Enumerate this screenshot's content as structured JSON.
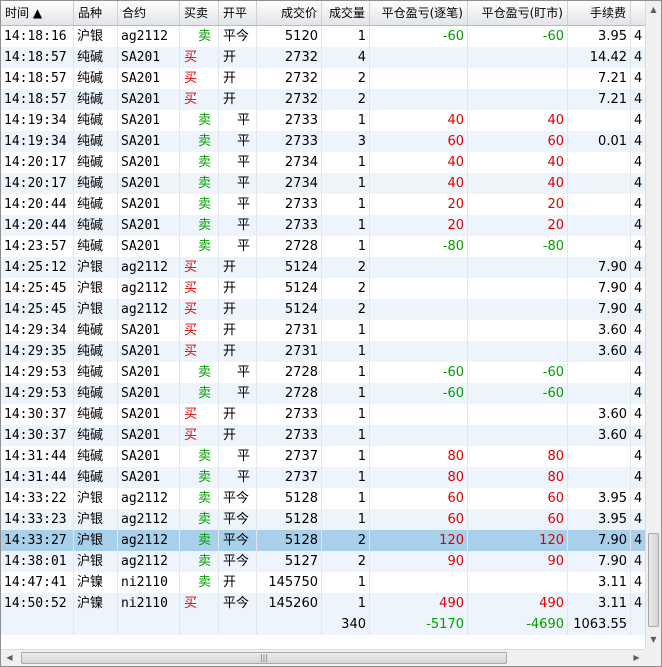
{
  "columns": [
    "时间 ▲",
    "品种",
    "合约",
    "买卖",
    "开平",
    "成交价",
    "成交量",
    "平仓盈亏(逐笔)",
    "平仓盈亏(盯市)",
    "手续费"
  ],
  "rows": [
    {
      "time": "14:18:16",
      "product": "沪银",
      "contract": "ag2112",
      "side": "卖",
      "action": "平今",
      "price": "5120",
      "qty": "1",
      "pnl_trade": "-60",
      "pnl_mtm": "-60",
      "fee": "3.95",
      "extra": "4"
    },
    {
      "time": "14:18:57",
      "product": "纯碱",
      "contract": "SA201",
      "side": "买",
      "action": "开",
      "price": "2732",
      "qty": "4",
      "pnl_trade": "",
      "pnl_mtm": "",
      "fee": "14.42",
      "extra": "4"
    },
    {
      "time": "14:18:57",
      "product": "纯碱",
      "contract": "SA201",
      "side": "买",
      "action": "开",
      "price": "2732",
      "qty": "2",
      "pnl_trade": "",
      "pnl_mtm": "",
      "fee": "7.21",
      "extra": "4"
    },
    {
      "time": "14:18:57",
      "product": "纯碱",
      "contract": "SA201",
      "side": "买",
      "action": "开",
      "price": "2732",
      "qty": "2",
      "pnl_trade": "",
      "pnl_mtm": "",
      "fee": "7.21",
      "extra": "4"
    },
    {
      "time": "14:19:34",
      "product": "纯碱",
      "contract": "SA201",
      "side": "卖",
      "action": "平",
      "price": "2733",
      "qty": "1",
      "pnl_trade": "40",
      "pnl_mtm": "40",
      "fee": "",
      "extra": "4"
    },
    {
      "time": "14:19:34",
      "product": "纯碱",
      "contract": "SA201",
      "side": "卖",
      "action": "平",
      "price": "2733",
      "qty": "3",
      "pnl_trade": "60",
      "pnl_mtm": "60",
      "fee": "0.01",
      "extra": "4"
    },
    {
      "time": "14:20:17",
      "product": "纯碱",
      "contract": "SA201",
      "side": "卖",
      "action": "平",
      "price": "2734",
      "qty": "1",
      "pnl_trade": "40",
      "pnl_mtm": "40",
      "fee": "",
      "extra": "4"
    },
    {
      "time": "14:20:17",
      "product": "纯碱",
      "contract": "SA201",
      "side": "卖",
      "action": "平",
      "price": "2734",
      "qty": "1",
      "pnl_trade": "40",
      "pnl_mtm": "40",
      "fee": "",
      "extra": "4"
    },
    {
      "time": "14:20:44",
      "product": "纯碱",
      "contract": "SA201",
      "side": "卖",
      "action": "平",
      "price": "2733",
      "qty": "1",
      "pnl_trade": "20",
      "pnl_mtm": "20",
      "fee": "",
      "extra": "4"
    },
    {
      "time": "14:20:44",
      "product": "纯碱",
      "contract": "SA201",
      "side": "卖",
      "action": "平",
      "price": "2733",
      "qty": "1",
      "pnl_trade": "20",
      "pnl_mtm": "20",
      "fee": "",
      "extra": "4"
    },
    {
      "time": "14:23:57",
      "product": "纯碱",
      "contract": "SA201",
      "side": "卖",
      "action": "平",
      "price": "2728",
      "qty": "1",
      "pnl_trade": "-80",
      "pnl_mtm": "-80",
      "fee": "",
      "extra": "4"
    },
    {
      "time": "14:25:12",
      "product": "沪银",
      "contract": "ag2112",
      "side": "买",
      "action": "开",
      "price": "5124",
      "qty": "2",
      "pnl_trade": "",
      "pnl_mtm": "",
      "fee": "7.90",
      "extra": "4"
    },
    {
      "time": "14:25:45",
      "product": "沪银",
      "contract": "ag2112",
      "side": "买",
      "action": "开",
      "price": "5124",
      "qty": "2",
      "pnl_trade": "",
      "pnl_mtm": "",
      "fee": "7.90",
      "extra": "4"
    },
    {
      "time": "14:25:45",
      "product": "沪银",
      "contract": "ag2112",
      "side": "买",
      "action": "开",
      "price": "5124",
      "qty": "2",
      "pnl_trade": "",
      "pnl_mtm": "",
      "fee": "7.90",
      "extra": "4"
    },
    {
      "time": "14:29:34",
      "product": "纯碱",
      "contract": "SA201",
      "side": "买",
      "action": "开",
      "price": "2731",
      "qty": "1",
      "pnl_trade": "",
      "pnl_mtm": "",
      "fee": "3.60",
      "extra": "4"
    },
    {
      "time": "14:29:35",
      "product": "纯碱",
      "contract": "SA201",
      "side": "买",
      "action": "开",
      "price": "2731",
      "qty": "1",
      "pnl_trade": "",
      "pnl_mtm": "",
      "fee": "3.60",
      "extra": "4"
    },
    {
      "time": "14:29:53",
      "product": "纯碱",
      "contract": "SA201",
      "side": "卖",
      "action": "平",
      "price": "2728",
      "qty": "1",
      "pnl_trade": "-60",
      "pnl_mtm": "-60",
      "fee": "",
      "extra": "4"
    },
    {
      "time": "14:29:53",
      "product": "纯碱",
      "contract": "SA201",
      "side": "卖",
      "action": "平",
      "price": "2728",
      "qty": "1",
      "pnl_trade": "-60",
      "pnl_mtm": "-60",
      "fee": "",
      "extra": "4"
    },
    {
      "time": "14:30:37",
      "product": "纯碱",
      "contract": "SA201",
      "side": "买",
      "action": "开",
      "price": "2733",
      "qty": "1",
      "pnl_trade": "",
      "pnl_mtm": "",
      "fee": "3.60",
      "extra": "4"
    },
    {
      "time": "14:30:37",
      "product": "纯碱",
      "contract": "SA201",
      "side": "买",
      "action": "开",
      "price": "2733",
      "qty": "1",
      "pnl_trade": "",
      "pnl_mtm": "",
      "fee": "3.60",
      "extra": "4"
    },
    {
      "time": "14:31:44",
      "product": "纯碱",
      "contract": "SA201",
      "side": "卖",
      "action": "平",
      "price": "2737",
      "qty": "1",
      "pnl_trade": "80",
      "pnl_mtm": "80",
      "fee": "",
      "extra": "4"
    },
    {
      "time": "14:31:44",
      "product": "纯碱",
      "contract": "SA201",
      "side": "卖",
      "action": "平",
      "price": "2737",
      "qty": "1",
      "pnl_trade": "80",
      "pnl_mtm": "80",
      "fee": "",
      "extra": "4"
    },
    {
      "time": "14:33:22",
      "product": "沪银",
      "contract": "ag2112",
      "side": "卖",
      "action": "平今",
      "price": "5128",
      "qty": "1",
      "pnl_trade": "60",
      "pnl_mtm": "60",
      "fee": "3.95",
      "extra": "4"
    },
    {
      "time": "14:33:23",
      "product": "沪银",
      "contract": "ag2112",
      "side": "卖",
      "action": "平今",
      "price": "5128",
      "qty": "1",
      "pnl_trade": "60",
      "pnl_mtm": "60",
      "fee": "3.95",
      "extra": "4"
    },
    {
      "time": "14:33:27",
      "product": "沪银",
      "contract": "ag2112",
      "side": "卖",
      "action": "平今",
      "price": "5128",
      "qty": "2",
      "pnl_trade": "120",
      "pnl_mtm": "120",
      "fee": "7.90",
      "extra": "4",
      "selected": true
    },
    {
      "time": "14:38:01",
      "product": "沪银",
      "contract": "ag2112",
      "side": "卖",
      "action": "平今",
      "price": "5127",
      "qty": "2",
      "pnl_trade": "90",
      "pnl_mtm": "90",
      "fee": "7.90",
      "extra": "4"
    },
    {
      "time": "14:47:41",
      "product": "沪镍",
      "contract": "ni2110",
      "side": "卖",
      "action": "开",
      "price": "145750",
      "qty": "1",
      "pnl_trade": "",
      "pnl_mtm": "",
      "fee": "3.11",
      "extra": "4"
    },
    {
      "time": "14:50:52",
      "product": "沪镍",
      "contract": "ni2110",
      "side": "买",
      "action": "平今",
      "price": "145260",
      "qty": "1",
      "pnl_trade": "490",
      "pnl_mtm": "490",
      "fee": "3.11",
      "extra": "4"
    }
  ],
  "totals": {
    "qty": "340",
    "pnl_trade": "-5170",
    "pnl_mtm": "-4690",
    "fee": "1063.55"
  },
  "colors": {
    "buy": "#e00000",
    "sell": "#00a000",
    "selected_row": "#a9d0ea",
    "alt_row": "#eef4fb"
  },
  "scrollbar": {
    "up_icon": "▲",
    "down_icon": "▼",
    "left_icon": "◀",
    "right_icon": "▶",
    "grip": "|||"
  }
}
